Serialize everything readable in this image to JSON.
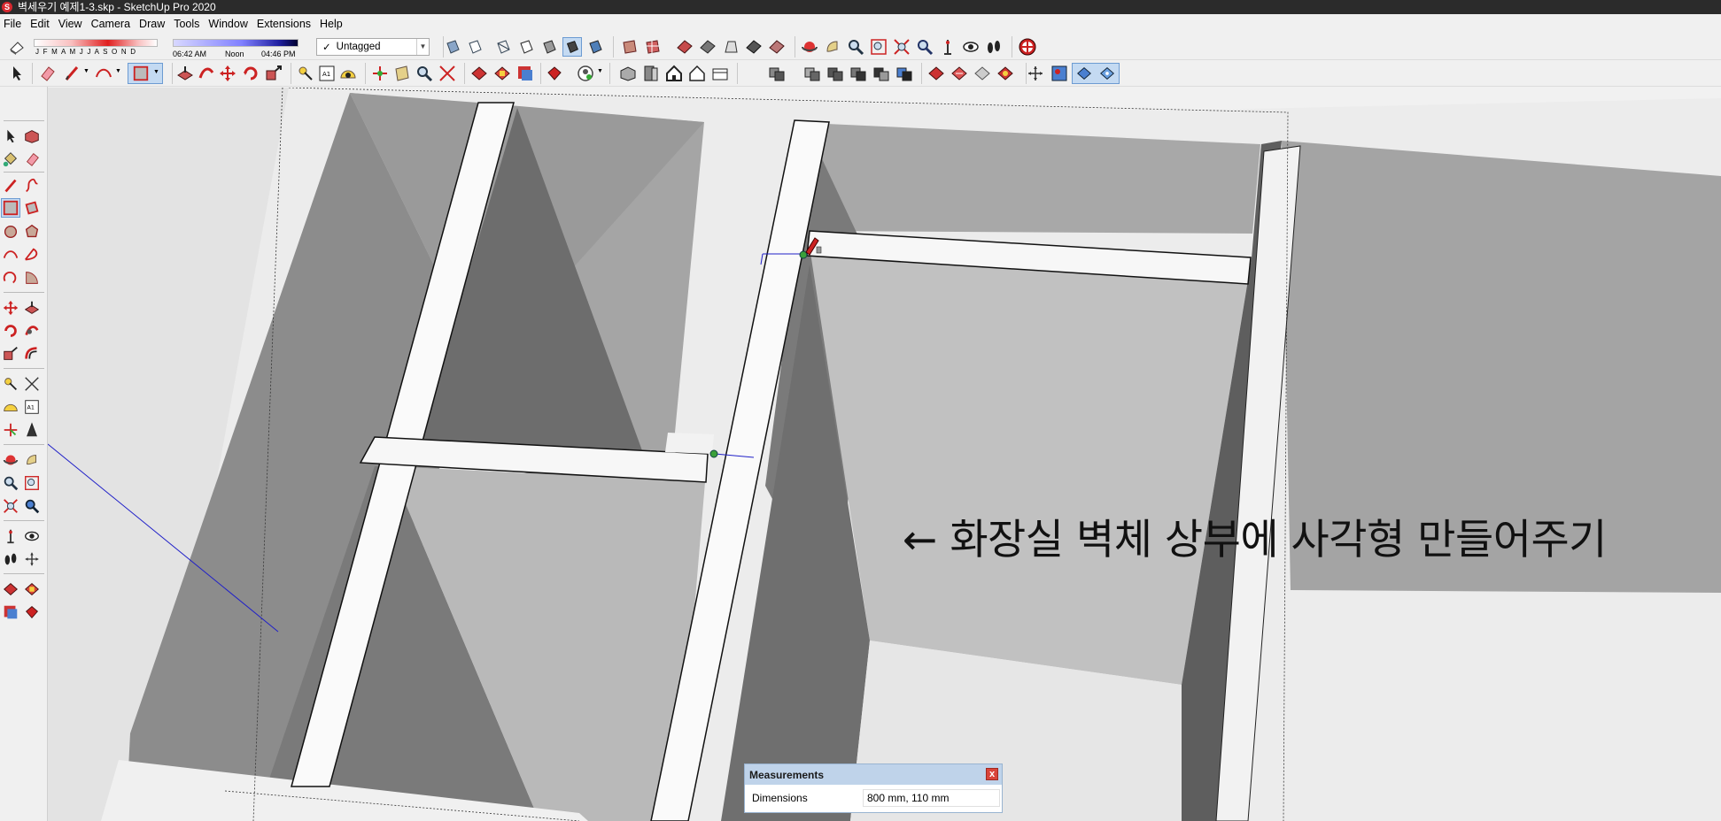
{
  "window": {
    "title": "벽세우기 예제1-3.skp - SketchUp Pro 2020",
    "app_icon": "sketchup-logo-icon"
  },
  "menu": [
    "File",
    "Edit",
    "View",
    "Camera",
    "Draw",
    "Tools",
    "Window",
    "Extensions",
    "Help"
  ],
  "shadows": {
    "months": "J F M A M J J A S O N D",
    "time_start": "06:42 AM",
    "time_mid": "Noon",
    "time_end": "04:46 PM"
  },
  "tag": {
    "check": "✓",
    "selected": "Untagged"
  },
  "viewport": {
    "annotation": "← 화장실 벽체 상부에 사각형 만들어주기"
  },
  "measurements": {
    "title": "Measurements",
    "close": "x",
    "label": "Dimensions",
    "value": "800 mm, 110 mm"
  },
  "colors": {
    "accent_red": "#d8282f",
    "axis_blue": "#2020c8",
    "inference_green": "#3aa03a"
  }
}
